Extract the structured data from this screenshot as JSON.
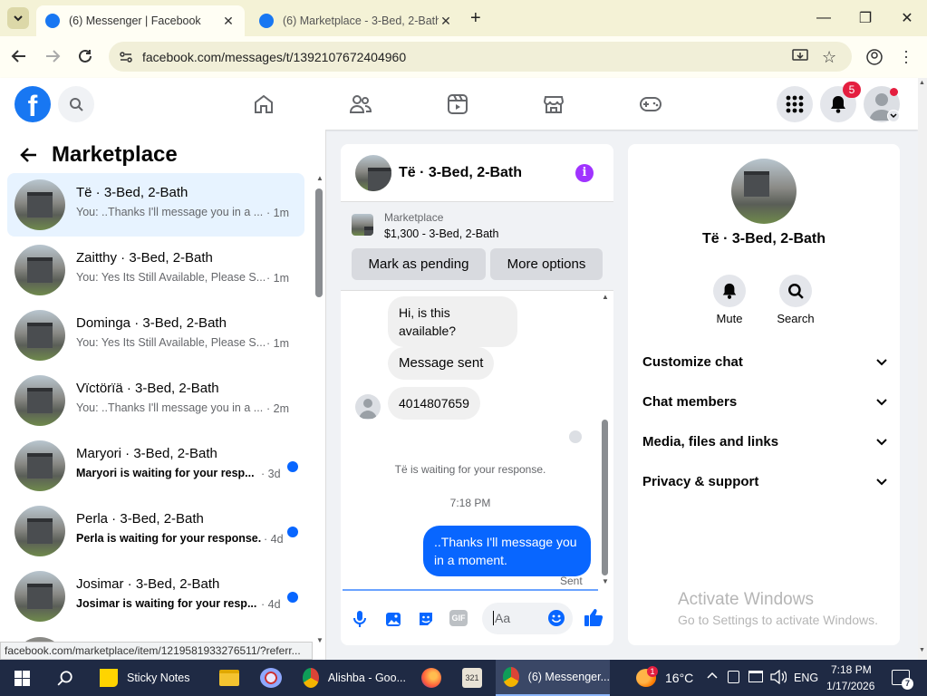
{
  "browser": {
    "tabs": [
      {
        "title": "(6) Messenger | Facebook"
      },
      {
        "title": "(6) Marketplace - 3-Bed, 2-Bath"
      }
    ],
    "url": "facebook.com/messages/t/1392107672404960",
    "status_url": "facebook.com/marketplace/item/1219581933276511/?referr..."
  },
  "header": {
    "notification_count": "5"
  },
  "left": {
    "title": "Marketplace",
    "conversations": [
      {
        "name": "Të · 3-Bed, 2-Bath",
        "preview": "You: ..Thanks I'll message you in a ...",
        "time": "· 1m",
        "unread": false
      },
      {
        "name": "Zaitthy · 3-Bed, 2-Bath",
        "preview": "You: Yes Its Still Available, Please S...",
        "time": "· 1m",
        "unread": false
      },
      {
        "name": "Dominga · 3-Bed, 2-Bath",
        "preview": "You: Yes Its Still Available, Please S...",
        "time": "· 1m",
        "unread": false
      },
      {
        "name": "Vïctörïä · 3-Bed, 2-Bath",
        "preview": "You: ..Thanks I'll message you in a ...",
        "time": "· 2m",
        "unread": false
      },
      {
        "name": "Maryori · 3-Bed, 2-Bath",
        "preview": "Maryori is waiting for your resp...",
        "time": "· 3d",
        "unread": true
      },
      {
        "name": "Perla · 3-Bed, 2-Bath",
        "preview": "Perla is waiting for your response.",
        "time": "· 4d",
        "unread": true
      },
      {
        "name": "Josimar · 3-Bed, 2-Bath",
        "preview": "Josimar is waiting for your resp...",
        "time": "· 4d",
        "unread": true
      }
    ]
  },
  "chat": {
    "title": "Të · 3-Bed, 2-Bath",
    "listing_label": "Marketplace",
    "listing_price": "$1,300 - 3-Bed, 2-Bath",
    "mark_pending": "Mark as pending",
    "more_options": "More options",
    "msg1": "Hi, is this available?",
    "msg2": "Message sent",
    "msg3": "4014807659",
    "waiting": "Të is waiting for your response.",
    "time": "7:18 PM",
    "outgoing": "..Thanks I'll message you in a moment.",
    "sent": "Sent",
    "input_placeholder": "Aa"
  },
  "right": {
    "title": "Të · 3-Bed, 2-Bath",
    "mute": "Mute",
    "search": "Search",
    "sections": [
      "Customize chat",
      "Chat members",
      "Media, files and links",
      "Privacy & support"
    ],
    "watermark_title": "Activate Windows",
    "watermark_sub": "Go to Settings to activate Windows."
  },
  "taskbar": {
    "sticky": "Sticky Notes",
    "chrome1": "Alishba - Goo...",
    "chrome2": "(6) Messenger...",
    "temp": "16°C",
    "lang": "ENG",
    "time": "7:18 PM",
    "date": "1/17/2026",
    "weather_badge": "1",
    "notif_badge": "7"
  },
  "colors": {
    "brand": "#1877f2",
    "messenger_blue": "#0866ff",
    "accent_purple": "#a033ff"
  }
}
